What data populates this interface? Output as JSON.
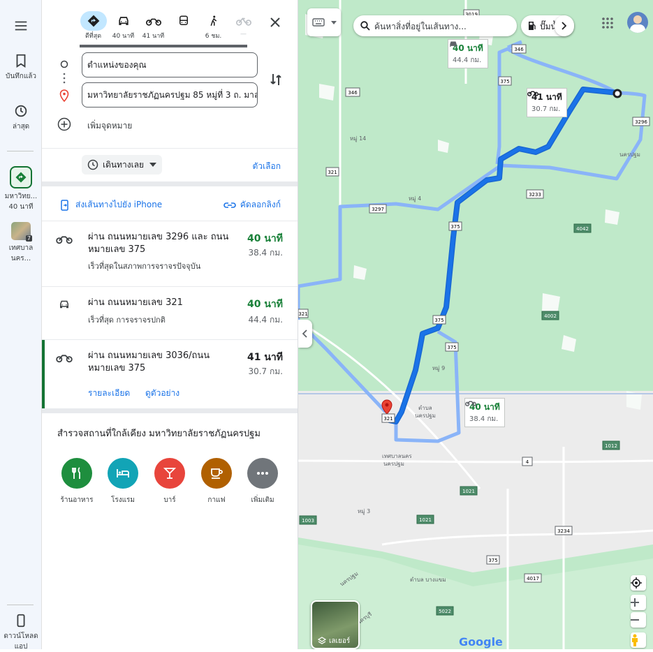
{
  "rail": {
    "saved": "บันทึกแล้ว",
    "recent": "ล่าสุด",
    "dest_line1": "มหาวิทย...",
    "dest_line2": "40 นาที",
    "muni_line1": "เทศบาล",
    "muni_line2": "นคร...",
    "muni_badge": "7",
    "download_line1": "ดาวน์โหลด",
    "download_line2": "แอป"
  },
  "modes": [
    {
      "label": "ดีที่สุด",
      "icon": "directions-icon",
      "selected": true
    },
    {
      "label": "40 นาที",
      "icon": "car-icon"
    },
    {
      "label": "41 นาที",
      "icon": "motorcycle-icon"
    },
    {
      "label": "",
      "icon": "bus-icon"
    },
    {
      "label": "6 ชม.",
      "icon": "walk-icon"
    },
    {
      "label": "—",
      "icon": "bicycle-icon"
    }
  ],
  "inputs": {
    "origin": "ตำแหน่งของคุณ",
    "destination": "มหาวิทยาลัยราชภัฏนครปฐม 85 หมู่ที่ 3 ถ. มาล",
    "add_stop": "เพิ่มจุดหมาย"
  },
  "depart": {
    "label": "เดินทางเลย",
    "options": "ตัวเลือก"
  },
  "share": {
    "send_iphone": "ส่งเส้นทางไปยัง iPhone",
    "copy_link": "คัดลอกลิงก์"
  },
  "routes": [
    {
      "title": "ผ่าน ถนนหมายเลข 3296 และ ถนนหมายเลข 375",
      "sub": "เร็วที่สุดในสภาพการจราจรปัจจุบัน",
      "duration": "40 นาที",
      "distance": "38.4 กม.",
      "icon": "motorcycle-icon",
      "duration_color": "#188038"
    },
    {
      "title": "ผ่าน ถนนหมายเลข 321",
      "sub": "เร็วที่สุด การจราจรปกติ",
      "duration": "40 นาที",
      "distance": "44.4 กม.",
      "icon": "car-icon",
      "duration_color": "#188038"
    },
    {
      "title": "ผ่าน ถนนหมายเลข 3036/ถนนหมายเลข 375",
      "sub": "",
      "duration": "41 นาที",
      "distance": "30.7 กม.",
      "icon": "motorcycle-icon",
      "duration_color": "#202124",
      "details": "รายละเอียด",
      "preview": "ดูตัวอย่าง",
      "selected": true
    }
  ],
  "explore": {
    "title": "สำรวจสถานที่ใกล้เคียง มหาวิทยาลัยราชภัฏนครปฐม",
    "categories": [
      {
        "label": "ร้านอาหาร",
        "color": "#1e8e3e",
        "icon": "restaurant-icon"
      },
      {
        "label": "โรงแรม",
        "color": "#12a4b6",
        "icon": "hotel-icon"
      },
      {
        "label": "บาร์",
        "color": "#e8453c",
        "icon": "bar-icon"
      },
      {
        "label": "กาแฟ",
        "color": "#b06000",
        "icon": "coffee-icon"
      },
      {
        "label": "เพิ่มเติม",
        "color": "#70757a",
        "icon": "more-icon"
      }
    ]
  },
  "map": {
    "search_placeholder": "ค้นหาสิ่งที่อยู่ในเส้นทาง...",
    "gas_chip": "ปั๊มน้ำ",
    "layers": "เลเยอร์",
    "google": "Google",
    "callout_car": {
      "time": "40 นาที",
      "dist": "44.4 กม."
    },
    "callout_moto41": {
      "time": "41 นาที",
      "dist": "30.7 กม."
    },
    "callout_moto40": {
      "time": "40 นาที",
      "dist": "38.4 กม."
    },
    "labels": {
      "muni": "เทศบาลนคร",
      "muni2": "นครปฐม",
      "tambon": "ตำบล",
      "tambon2": "นครปฐม",
      "nakhon": "นครปฐม",
      "moo14": "หมู่ 14",
      "moo4": "หมู่ 4",
      "moo9": "หมู่ 9",
      "moo3": "หมู่ 3",
      "tambon_bang": "ตำบล บางแขม",
      "nakhonpathom_right": "นครปฐม",
      "suphan": "นครบุรี"
    },
    "shields": [
      "3019",
      "346",
      "375",
      "3296",
      "346",
      "321",
      "3297",
      "3233",
      "375",
      "4042",
      "4002",
      "375",
      "375",
      "321",
      "1012",
      "4",
      "1021",
      "1003",
      "1021",
      "3234",
      "375",
      "4017",
      "5022",
      "321"
    ]
  }
}
